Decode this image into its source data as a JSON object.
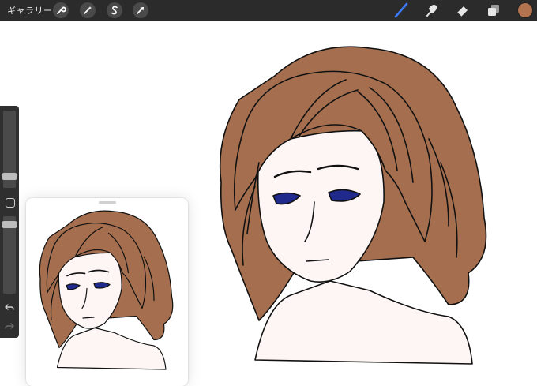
{
  "toolbar": {
    "gallery_label": "ギャラリー",
    "left_tools": [
      "wrench-icon",
      "magic-wand-icon",
      "selection-icon",
      "transform-icon"
    ],
    "right_tools": [
      "brush-icon",
      "smudge-icon",
      "eraser-icon",
      "layers-icon"
    ],
    "brush_active_color": "#3d7bff",
    "current_color": "#b3734f"
  },
  "sidebar": {
    "buttons": [
      "brush-size-slider",
      "modify-button",
      "opacity-slider",
      "undo-icon",
      "redo-icon"
    ]
  },
  "artwork": {
    "hair_color": "#a56f4f",
    "skin_color": "#fdf6f4",
    "eye_color": "#1f2a8c"
  }
}
